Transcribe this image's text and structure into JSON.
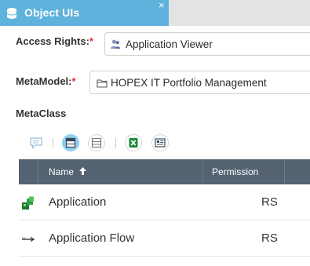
{
  "tab": {
    "title": "Object UIs",
    "close": "×",
    "icon": "database-icon",
    "accent_color": "#5eb2db"
  },
  "form": {
    "access_rights": {
      "label": "Access Rights:",
      "required_mark": "*",
      "value": "Application Viewer",
      "icon": "user-icon"
    },
    "metamodel": {
      "label": "MetaModel:",
      "required_mark": "*",
      "value": "HOPEX IT Portfolio Management",
      "icon": "folder-icon"
    },
    "metaclass": {
      "label": "MetaClass"
    }
  },
  "toolbar": {
    "buttons": [
      {
        "name": "comment-icon",
        "active": false
      },
      {
        "name": "panel-top-icon",
        "active": true
      },
      {
        "name": "panel-icon",
        "active": false
      },
      {
        "name": "excel-icon",
        "active": false
      },
      {
        "name": "report-icon",
        "active": false
      }
    ]
  },
  "table": {
    "header_color": "#546272",
    "columns": [
      {
        "label": "Name",
        "sort": "ascending",
        "sort_icon": "arrow-up-icon"
      },
      {
        "label": "Permission"
      }
    ],
    "rows": [
      {
        "name": "Application",
        "permission": "RS",
        "icon": "application-icon"
      },
      {
        "name": "Application Flow",
        "permission": "RS",
        "icon": "flow-arrow-icon"
      }
    ]
  }
}
